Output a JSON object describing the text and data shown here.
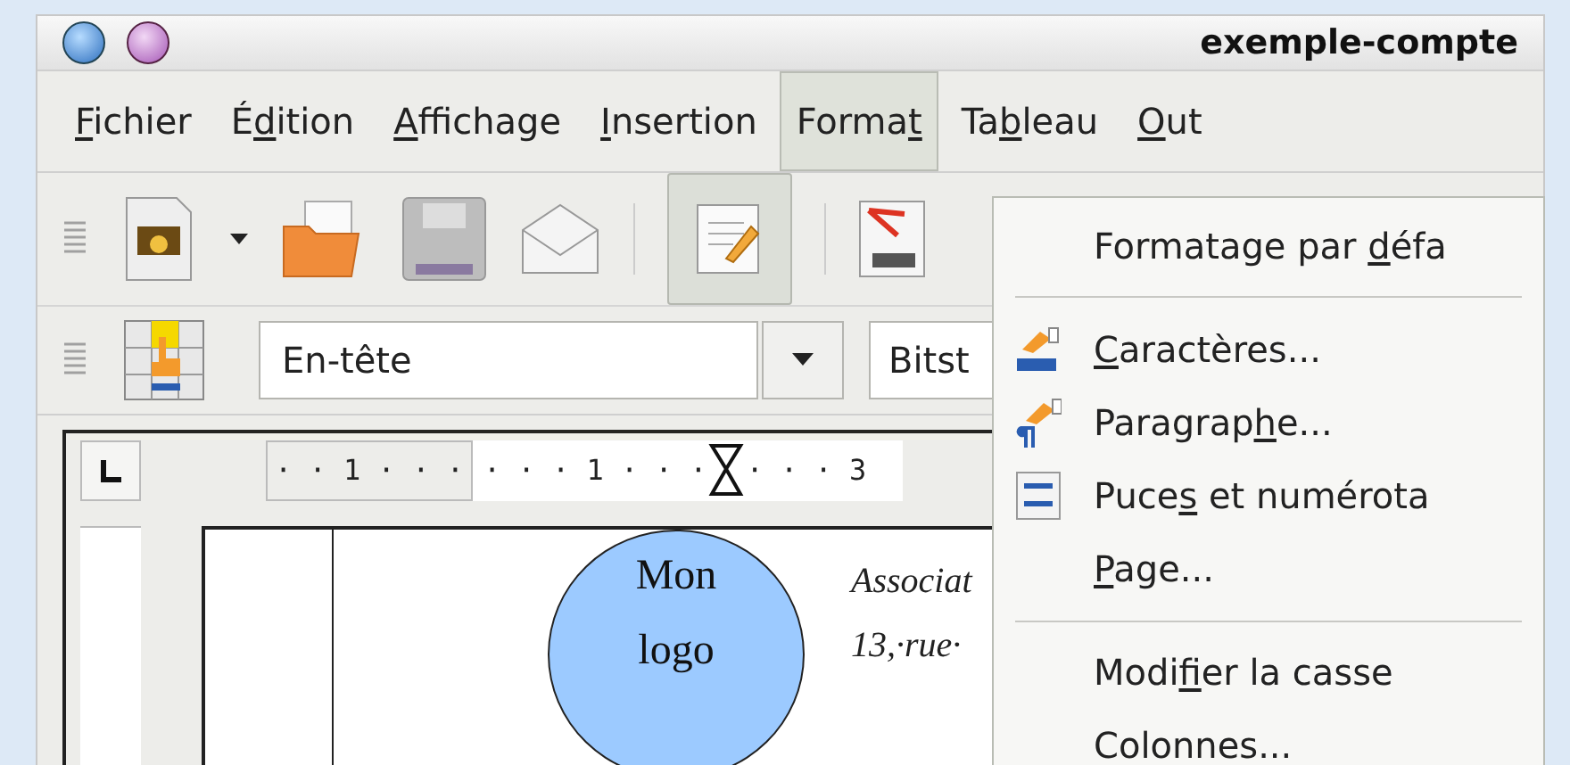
{
  "window": {
    "title": "exemple-compte"
  },
  "menubar": [
    {
      "key": "F",
      "after": "ichier",
      "selected": false
    },
    {
      "before": "É",
      "key": "d",
      "after": "ition",
      "selected": false
    },
    {
      "key": "A",
      "after": "ffichage",
      "selected": false
    },
    {
      "key": "I",
      "after": "nsertion",
      "selected": false
    },
    {
      "before": "Forma",
      "key": "t",
      "selected": true
    },
    {
      "before": "Ta",
      "key": "b",
      "after": "leau",
      "selected": false
    },
    {
      "key": "O",
      "after": "ut",
      "selected": false
    }
  ],
  "toolbar": {
    "style_combo": {
      "value": "En-tête"
    },
    "font_combo": {
      "value": "Bitst"
    }
  },
  "ruler": {
    "segments": [
      "· · 1 · · ·",
      "· · · 1 · · ·",
      "· · · 3"
    ]
  },
  "document": {
    "logo": [
      "Mon",
      "logo"
    ],
    "lines": [
      "Associat",
      "13,·rue·"
    ]
  },
  "format_menu": [
    {
      "kind": "plain",
      "before": "Formatage par ",
      "key": "d",
      "after": "éfa"
    },
    {
      "kind": "separator"
    },
    {
      "kind": "abc",
      "key": "C",
      "after": "aractères..."
    },
    {
      "kind": "pilcrow",
      "before": "Paragrap",
      "key": "h",
      "after": "e..."
    },
    {
      "kind": "list",
      "before": "Puce",
      "key": "s",
      "after": " et numérota"
    },
    {
      "kind": "plain",
      "key": "P",
      "after": "age..."
    },
    {
      "kind": "separator"
    },
    {
      "kind": "plain",
      "before": "Modi",
      "key": "f",
      "after": "ier la casse"
    },
    {
      "kind": "plain",
      "before": "Colonnes..."
    }
  ]
}
